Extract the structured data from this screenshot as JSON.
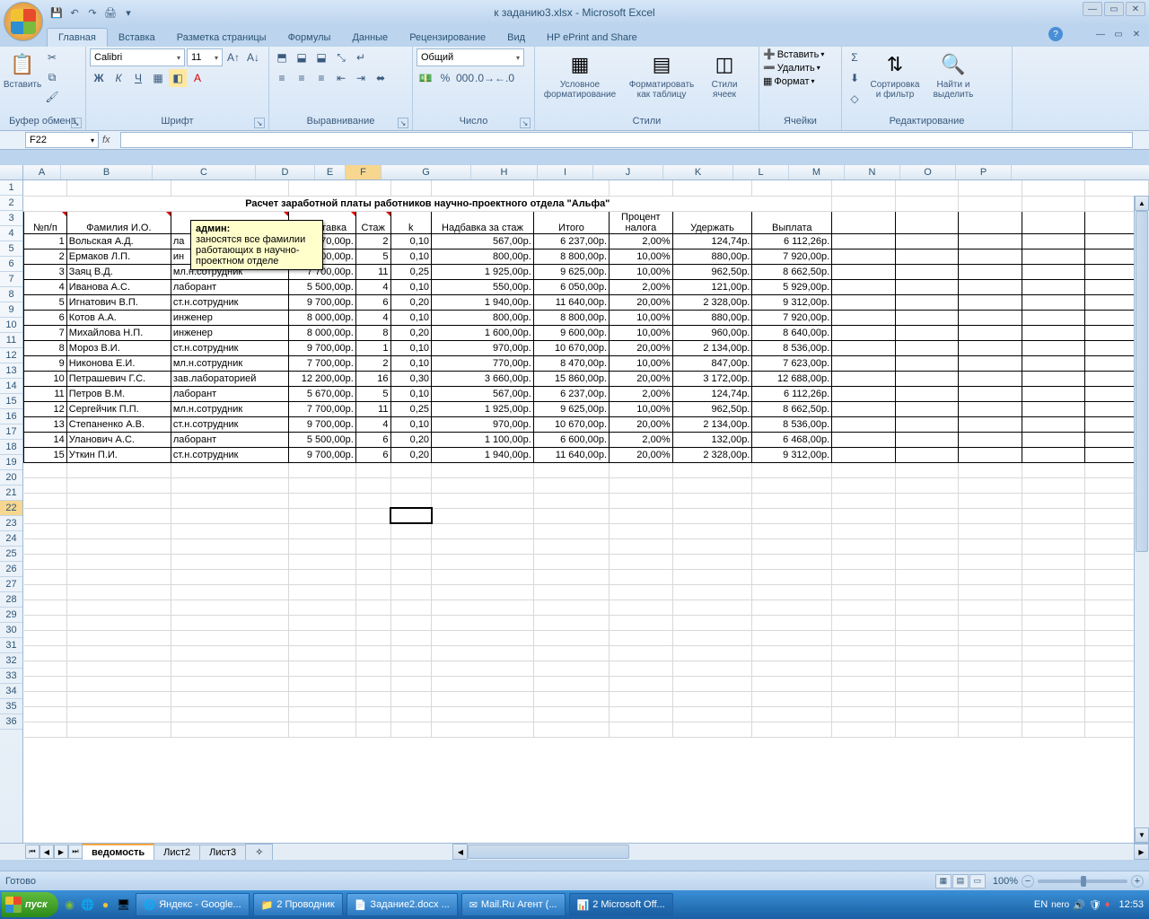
{
  "title": "к заданию3.xlsx - Microsoft Excel",
  "qat_icons": [
    "save-icon",
    "undo-icon",
    "redo-icon",
    "print-icon",
    "customize-icon"
  ],
  "tabs": [
    "Главная",
    "Вставка",
    "Разметка страницы",
    "Формулы",
    "Данные",
    "Рецензирование",
    "Вид",
    "HP ePrint and Share"
  ],
  "active_tab": 0,
  "ribbon": {
    "clipboard": {
      "label": "Буфер обмена",
      "paste": "Вставить"
    },
    "font": {
      "label": "Шрифт",
      "name": "Calibri",
      "size": "11"
    },
    "alignment": {
      "label": "Выравнивание"
    },
    "number": {
      "label": "Число",
      "format": "Общий"
    },
    "styles": {
      "label": "Стили",
      "cond": "Условное форматирование",
      "table": "Форматировать как таблицу",
      "cell": "Стили ячеек"
    },
    "cells": {
      "label": "Ячейки",
      "insert": "Вставить",
      "delete": "Удалить",
      "format": "Формат"
    },
    "editing": {
      "label": "Редактирование",
      "sort": "Сортировка и фильтр",
      "find": "Найти и выделить"
    }
  },
  "namebox": "F22",
  "columns": [
    "A",
    "B",
    "C",
    "D",
    "E",
    "F",
    "G",
    "H",
    "I",
    "J",
    "K",
    "L",
    "M",
    "N",
    "O",
    "P"
  ],
  "sheet": {
    "title": "Расчет заработной платы работников научно-проектного отдела \"Альфа\"",
    "headers": [
      "№п/п",
      "Фамилия И.О.",
      "",
      "ная ставка",
      "Стаж",
      "k",
      "Надбавка за стаж",
      "Итого",
      "Процент налога",
      "Удержать",
      "Выплата"
    ],
    "rows": [
      {
        "n": 1,
        "fio": "Вольская А.Д.",
        "pos": "ла",
        "rate": "5 670,00р.",
        "stazh": 2,
        "k": "0,10",
        "nadb": "567,00р.",
        "itogo": "6 237,00р.",
        "tax": "2,00%",
        "ud": "124,74р.",
        "pay": "6 112,26р."
      },
      {
        "n": 2,
        "fio": "Ермаков Л.П.",
        "pos": "ин",
        "rate": "8 000,00р.",
        "stazh": 5,
        "k": "0,10",
        "nadb": "800,00р.",
        "itogo": "8 800,00р.",
        "tax": "10,00%",
        "ud": "880,00р.",
        "pay": "7 920,00р."
      },
      {
        "n": 3,
        "fio": "Заяц В.Д.",
        "pos": "мл.н.сотрудник",
        "rate": "7 700,00р.",
        "stazh": 11,
        "k": "0,25",
        "nadb": "1 925,00р.",
        "itogo": "9 625,00р.",
        "tax": "10,00%",
        "ud": "962,50р.",
        "pay": "8 662,50р."
      },
      {
        "n": 4,
        "fio": "Иванова А.С.",
        "pos": "лаборант",
        "rate": "5 500,00р.",
        "stazh": 4,
        "k": "0,10",
        "nadb": "550,00р.",
        "itogo": "6 050,00р.",
        "tax": "2,00%",
        "ud": "121,00р.",
        "pay": "5 929,00р."
      },
      {
        "n": 5,
        "fio": "Игнатович В.П.",
        "pos": "ст.н.сотрудник",
        "rate": "9 700,00р.",
        "stazh": 6,
        "k": "0,20",
        "nadb": "1 940,00р.",
        "itogo": "11 640,00р.",
        "tax": "20,00%",
        "ud": "2 328,00р.",
        "pay": "9 312,00р."
      },
      {
        "n": 6,
        "fio": "Котов А.А.",
        "pos": "инженер",
        "rate": "8 000,00р.",
        "stazh": 4,
        "k": "0,10",
        "nadb": "800,00р.",
        "itogo": "8 800,00р.",
        "tax": "10,00%",
        "ud": "880,00р.",
        "pay": "7 920,00р."
      },
      {
        "n": 7,
        "fio": "Михайлова Н.П.",
        "pos": "инженер",
        "rate": "8 000,00р.",
        "stazh": 8,
        "k": "0,20",
        "nadb": "1 600,00р.",
        "itogo": "9 600,00р.",
        "tax": "10,00%",
        "ud": "960,00р.",
        "pay": "8 640,00р."
      },
      {
        "n": 8,
        "fio": "Мороз В.И.",
        "pos": "ст.н.сотрудник",
        "rate": "9 700,00р.",
        "stazh": 1,
        "k": "0,10",
        "nadb": "970,00р.",
        "itogo": "10 670,00р.",
        "tax": "20,00%",
        "ud": "2 134,00р.",
        "pay": "8 536,00р."
      },
      {
        "n": 9,
        "fio": "Никонова Е.И.",
        "pos": "мл.н.сотрудник",
        "rate": "7 700,00р.",
        "stazh": 2,
        "k": "0,10",
        "nadb": "770,00р.",
        "itogo": "8 470,00р.",
        "tax": "10,00%",
        "ud": "847,00р.",
        "pay": "7 623,00р."
      },
      {
        "n": 10,
        "fio": "Петрашевич Г.С.",
        "pos": "зав.лабораторией",
        "rate": "12 200,00р.",
        "stazh": 16,
        "k": "0,30",
        "nadb": "3 660,00р.",
        "itogo": "15 860,00р.",
        "tax": "20,00%",
        "ud": "3 172,00р.",
        "pay": "12 688,00р."
      },
      {
        "n": 11,
        "fio": "Петров В.М.",
        "pos": "лаборант",
        "rate": "5 670,00р.",
        "stazh": 5,
        "k": "0,10",
        "nadb": "567,00р.",
        "itogo": "6 237,00р.",
        "tax": "2,00%",
        "ud": "124,74р.",
        "pay": "6 112,26р."
      },
      {
        "n": 12,
        "fio": "Сергейчик П.П.",
        "pos": "мл.н.сотрудник",
        "rate": "7 700,00р.",
        "stazh": 11,
        "k": "0,25",
        "nadb": "1 925,00р.",
        "itogo": "9 625,00р.",
        "tax": "10,00%",
        "ud": "962,50р.",
        "pay": "8 662,50р."
      },
      {
        "n": 13,
        "fio": "Степаненко А.В.",
        "pos": "ст.н.сотрудник",
        "rate": "9 700,00р.",
        "stazh": 4,
        "k": "0,10",
        "nadb": "970,00р.",
        "itogo": "10 670,00р.",
        "tax": "20,00%",
        "ud": "2 134,00р.",
        "pay": "8 536,00р."
      },
      {
        "n": 14,
        "fio": "Уланович А.С.",
        "pos": "лаборант",
        "rate": "5 500,00р.",
        "stazh": 6,
        "k": "0,20",
        "nadb": "1 100,00р.",
        "itogo": "6 600,00р.",
        "tax": "2,00%",
        "ud": "132,00р.",
        "pay": "6 468,00р."
      },
      {
        "n": 15,
        "fio": "Уткин П.И.",
        "pos": "ст.н.сотрудник",
        "rate": "9 700,00р.",
        "stazh": 6,
        "k": "0,20",
        "nadb": "1 940,00р.",
        "itogo": "11 640,00р.",
        "tax": "20,00%",
        "ud": "2 328,00р.",
        "pay": "9 312,00р."
      }
    ],
    "red_tri_cols_header": [
      0,
      1,
      2,
      3,
      4
    ],
    "selected_cell": "F22"
  },
  "comment": {
    "author": "админ:",
    "text": "заносятся все фамилии работающих в научно-проектном отделе"
  },
  "sheet_tabs": [
    "ведомость",
    "Лист2",
    "Лист3"
  ],
  "status": "Готово",
  "zoom": "100%",
  "taskbar": {
    "start": "пуск",
    "items": [
      "Яндекс - Google...",
      "2 Проводник",
      "Задание2.docx ...",
      "Mail.Ru Агент (...",
      "2 Microsoft Off..."
    ],
    "lang": "EN",
    "clock": "12:53"
  }
}
